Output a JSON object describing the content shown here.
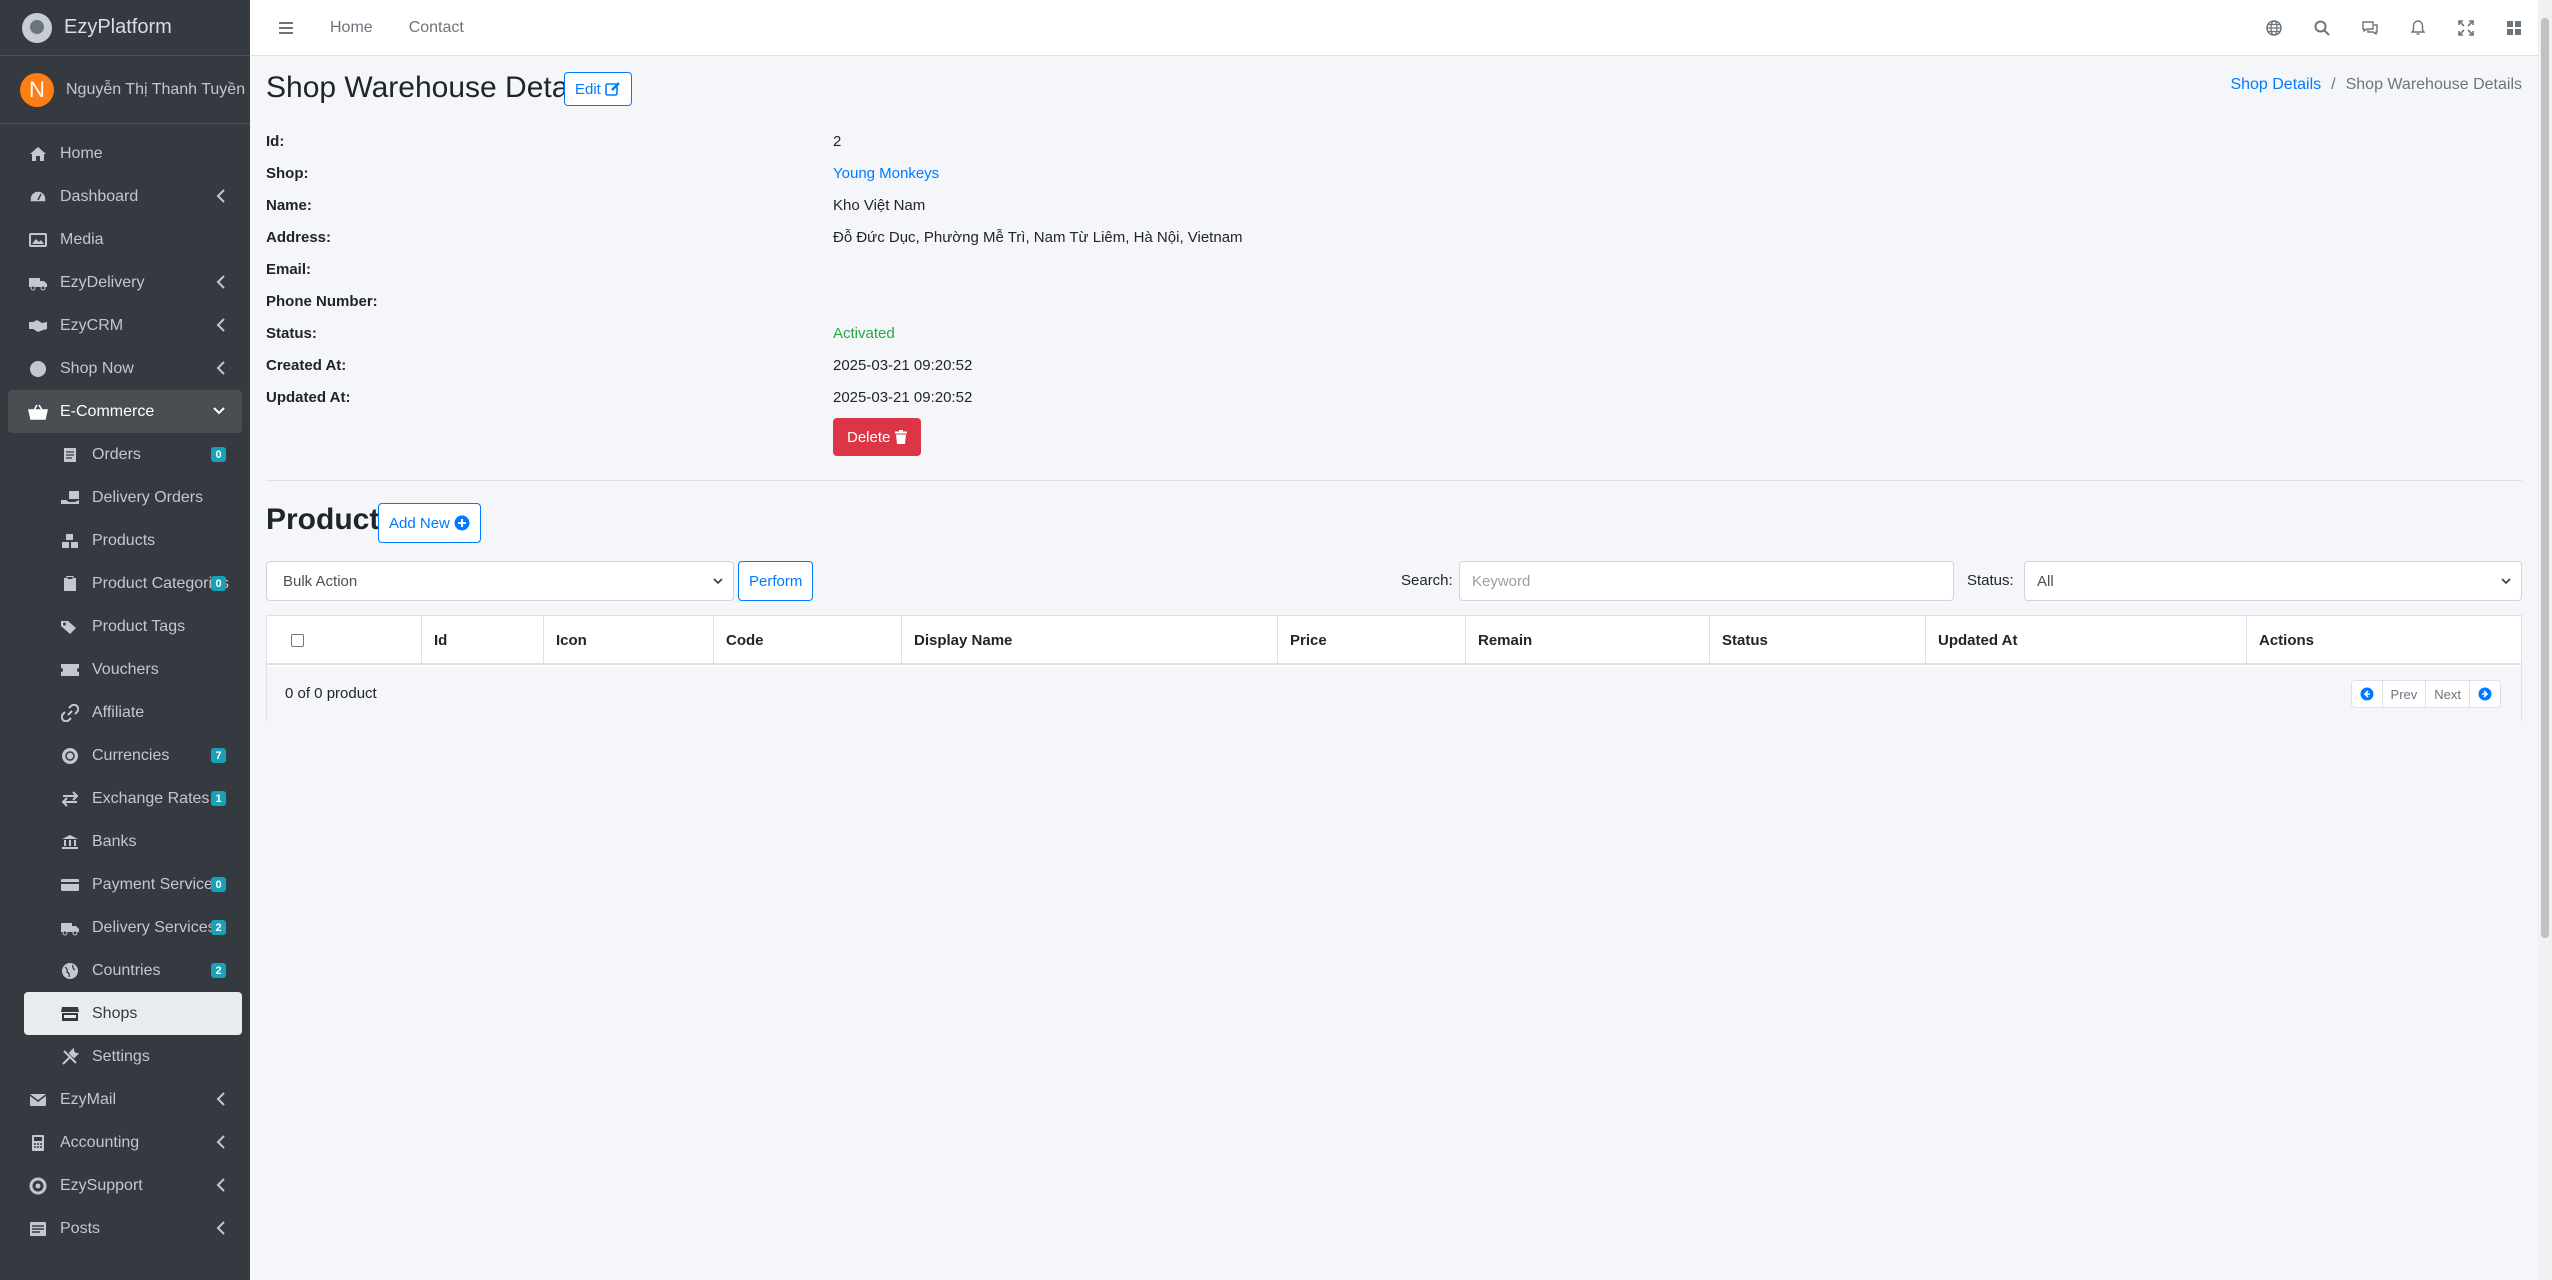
{
  "brand": {
    "name": "EzyPlatform"
  },
  "user": {
    "initial": "N",
    "name": "Nguyễn Thị Thanh Tuyền"
  },
  "sidebar": {
    "items": [
      {
        "label": "Home",
        "icon": "home-icon",
        "chevron": false
      },
      {
        "label": "Dashboard",
        "icon": "dashboard-icon",
        "chevron": true
      },
      {
        "label": "Media",
        "icon": "image-icon",
        "chevron": false
      },
      {
        "label": "EzyDelivery",
        "icon": "truck-icon",
        "chevron": true
      },
      {
        "label": "EzyCRM",
        "icon": "handshake-icon",
        "chevron": true
      },
      {
        "label": "Shop Now",
        "icon": "circle-icon",
        "chevron": true
      },
      {
        "label": "E-Commerce",
        "icon": "basket-icon",
        "chevron": true
      }
    ],
    "ecommerce_sub": [
      {
        "label": "Orders",
        "icon": "orders-icon",
        "badge": "0"
      },
      {
        "label": "Delivery Orders",
        "icon": "delivery-orders-icon",
        "badge": ""
      },
      {
        "label": "Products",
        "icon": "boxes-icon",
        "badge": ""
      },
      {
        "label": "Product Categories",
        "icon": "clipboard-icon",
        "badge": "0"
      },
      {
        "label": "Product Tags",
        "icon": "tags-icon",
        "badge": ""
      },
      {
        "label": "Vouchers",
        "icon": "ticket-icon",
        "badge": ""
      },
      {
        "label": "Affiliate",
        "icon": "link-icon",
        "badge": ""
      },
      {
        "label": "Currencies",
        "icon": "coins-icon",
        "badge": "7"
      },
      {
        "label": "Exchange Rates",
        "icon": "exchange-icon",
        "badge": "1"
      },
      {
        "label": "Banks",
        "icon": "bank-icon",
        "badge": ""
      },
      {
        "label": "Payment Services",
        "icon": "credit-card-icon",
        "badge": "0"
      },
      {
        "label": "Delivery Services",
        "icon": "truck-icon",
        "badge": "2"
      },
      {
        "label": "Countries",
        "icon": "globe-icon",
        "badge": "2"
      },
      {
        "label": "Shops",
        "icon": "store-icon",
        "badge": ""
      },
      {
        "label": "Settings",
        "icon": "tools-icon",
        "badge": ""
      }
    ],
    "bottom_items": [
      {
        "label": "EzyMail",
        "icon": "envelope-icon",
        "chevron": true
      },
      {
        "label": "Accounting",
        "icon": "calculator-icon",
        "chevron": true
      },
      {
        "label": "EzySupport",
        "icon": "lifebuoy-icon",
        "chevron": true
      },
      {
        "label": "Posts",
        "icon": "posts-icon",
        "chevron": true
      }
    ]
  },
  "topbar": {
    "links": [
      "Home",
      "Contact"
    ],
    "icons": [
      "globe-icon",
      "search-icon",
      "comments-icon",
      "bell-icon",
      "expand-icon",
      "apps-icon"
    ]
  },
  "page": {
    "title": "Shop Warehouse Details",
    "edit_label": "Edit",
    "breadcrumb": {
      "parent": "Shop Details",
      "current": "Shop Warehouse Details"
    }
  },
  "details": {
    "rows": [
      {
        "label": "Id:",
        "value": "2",
        "style": ""
      },
      {
        "label": "Shop:",
        "value": "Young Monkeys",
        "style": "link"
      },
      {
        "label": "Name:",
        "value": "Kho Việt Nam",
        "style": ""
      },
      {
        "label": "Address:",
        "value": "Đỗ Đức Dục, Phường Mễ Trì, Nam Từ Liêm, Hà Nội, Vietnam",
        "style": ""
      },
      {
        "label": "Email:",
        "value": "",
        "style": ""
      },
      {
        "label": "Phone Number:",
        "value": "",
        "style": ""
      },
      {
        "label": "Status:",
        "value": "Activated",
        "style": "green"
      },
      {
        "label": "Created At:",
        "value": "2025-03-21 09:20:52",
        "style": ""
      },
      {
        "label": "Updated At:",
        "value": "2025-03-21 09:20:52",
        "style": ""
      }
    ],
    "delete_label": "Delete"
  },
  "products": {
    "title": "Products",
    "add_new_label": "Add New",
    "bulk_action": "Bulk Action",
    "perform_label": "Perform",
    "search_label": "Search:",
    "search_placeholder": "Keyword",
    "status_label": "Status:",
    "status_value": "All",
    "columns": [
      "Id",
      "Icon",
      "Code",
      "Display Name",
      "Price",
      "Remain",
      "Status",
      "Updated At",
      "Actions"
    ],
    "count_text": "0 of 0 product",
    "prev_label": "Prev",
    "next_label": "Next"
  },
  "colors": {
    "sidebar_bg": "#343a40",
    "primary": "#007bff",
    "danger": "#dc3545",
    "success": "#28a745",
    "badge": "#17a2b8"
  }
}
